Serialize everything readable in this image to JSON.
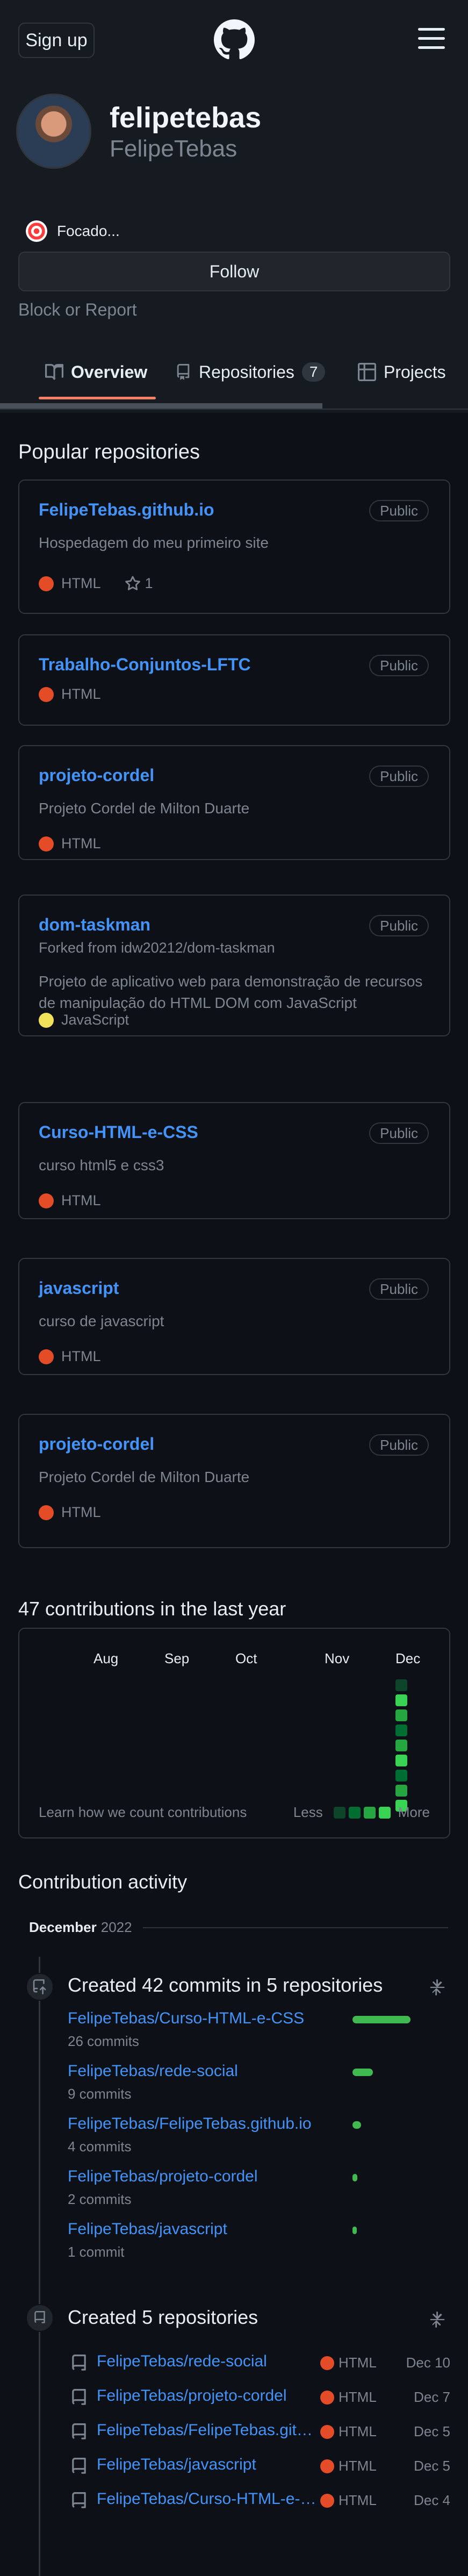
{
  "header": {
    "signup_label": "Sign up",
    "logo_icon": "github-logo-icon",
    "menu_icon": "hamburger-menu-icon"
  },
  "profile": {
    "name": "felipetebas",
    "login": "FelipeTebas",
    "status_text": "Focado...",
    "follow_label": "Follow",
    "block_label": "Block or Report"
  },
  "tabs": [
    {
      "label": "Overview",
      "icon": "book-icon",
      "active": true
    },
    {
      "label": "Repositories",
      "icon": "repo-icon",
      "count": "7"
    },
    {
      "label": "Projects",
      "icon": "table-icon"
    }
  ],
  "popular": {
    "title": "Popular repositories",
    "repos": [
      {
        "name": "FelipeTebas.github.io",
        "badge": "Public",
        "desc": "Hospedagem do meu primeiro site",
        "lang": "HTML",
        "lang_color": "#e34c26",
        "stars": "1"
      },
      {
        "name": "Trabalho-Conjuntos-LFTC",
        "badge": "Public",
        "lang": "HTML",
        "lang_color": "#e34c26"
      },
      {
        "name": "projeto-cordel",
        "badge": "Public",
        "desc": "Projeto Cordel de Milton Duarte",
        "lang": "HTML",
        "lang_color": "#e34c26"
      },
      {
        "name": "dom-taskman",
        "badge": "Public",
        "fork": "Forked from idw20212/dom-taskman",
        "desc": "Projeto de aplicativo web para demonstração de recursos de manipulação do HTML DOM com JavaScript",
        "lang": "JavaScript",
        "lang_color": "#f1e05a"
      },
      {
        "name": "Curso-HTML-e-CSS",
        "badge": "Public",
        "desc": "curso html5 e css3",
        "lang": "HTML",
        "lang_color": "#e34c26"
      },
      {
        "name": "javascript",
        "badge": "Public",
        "desc": "curso de javascript",
        "lang": "HTML",
        "lang_color": "#e34c26"
      },
      {
        "name": "projeto-cordel",
        "badge": "Public",
        "desc": "Projeto Cordel de Milton Duarte",
        "lang": "HTML",
        "lang_color": "#e34c26"
      }
    ]
  },
  "contributions": {
    "title": "47 contributions in the last year",
    "months": [
      "Aug",
      "Sep",
      "Oct",
      "Nov",
      "Dec"
    ],
    "learn_link": "Learn how we count contributions",
    "less": "Less",
    "more": "More",
    "legend_colors": [
      "#0e4429",
      "#006d32",
      "#26a641",
      "#39d353"
    ],
    "dec_cells": [
      "#0e4429",
      "#39d353",
      "#26a641",
      "#006d32",
      "#26a641",
      "#39d353",
      "#006d32",
      "#26a641",
      "#39d353"
    ]
  },
  "activity": {
    "title": "Contribution activity",
    "month": "December",
    "year": "2022",
    "commits": {
      "title": "Created 42 commits in 5 repositories",
      "items": [
        {
          "repo": "FelipeTebas/Curso-HTML-e-CSS",
          "count": "26 commits",
          "share": 1.0
        },
        {
          "repo": "FelipeTebas/rede-social",
          "count": "9 commits",
          "share": 0.35
        },
        {
          "repo": "FelipeTebas/FelipeTebas.github.io",
          "count": "4 commits",
          "share": 0.15
        },
        {
          "repo": "FelipeTebas/projeto-cordel",
          "count": "2 commits",
          "share": 0.08
        },
        {
          "repo": "FelipeTebas/javascript",
          "count": "1 commit",
          "share": 0.04
        }
      ]
    },
    "created": {
      "title": "Created 5 repositories",
      "items": [
        {
          "repo": "FelipeTebas/rede-social",
          "lang": "HTML",
          "date": "Dec 10"
        },
        {
          "repo": "FelipeTebas/projeto-cordel",
          "lang": "HTML",
          "date": "Dec 7"
        },
        {
          "repo": "FelipeTebas/FelipeTebas.github.io",
          "lang": "HTML",
          "date": "Dec 5"
        },
        {
          "repo": "FelipeTebas/javascript",
          "lang": "HTML",
          "date": "Dec 5"
        },
        {
          "repo": "FelipeTebas/Curso-HTML-e-CSS",
          "lang": "HTML",
          "date": "Dec 4"
        }
      ]
    }
  }
}
